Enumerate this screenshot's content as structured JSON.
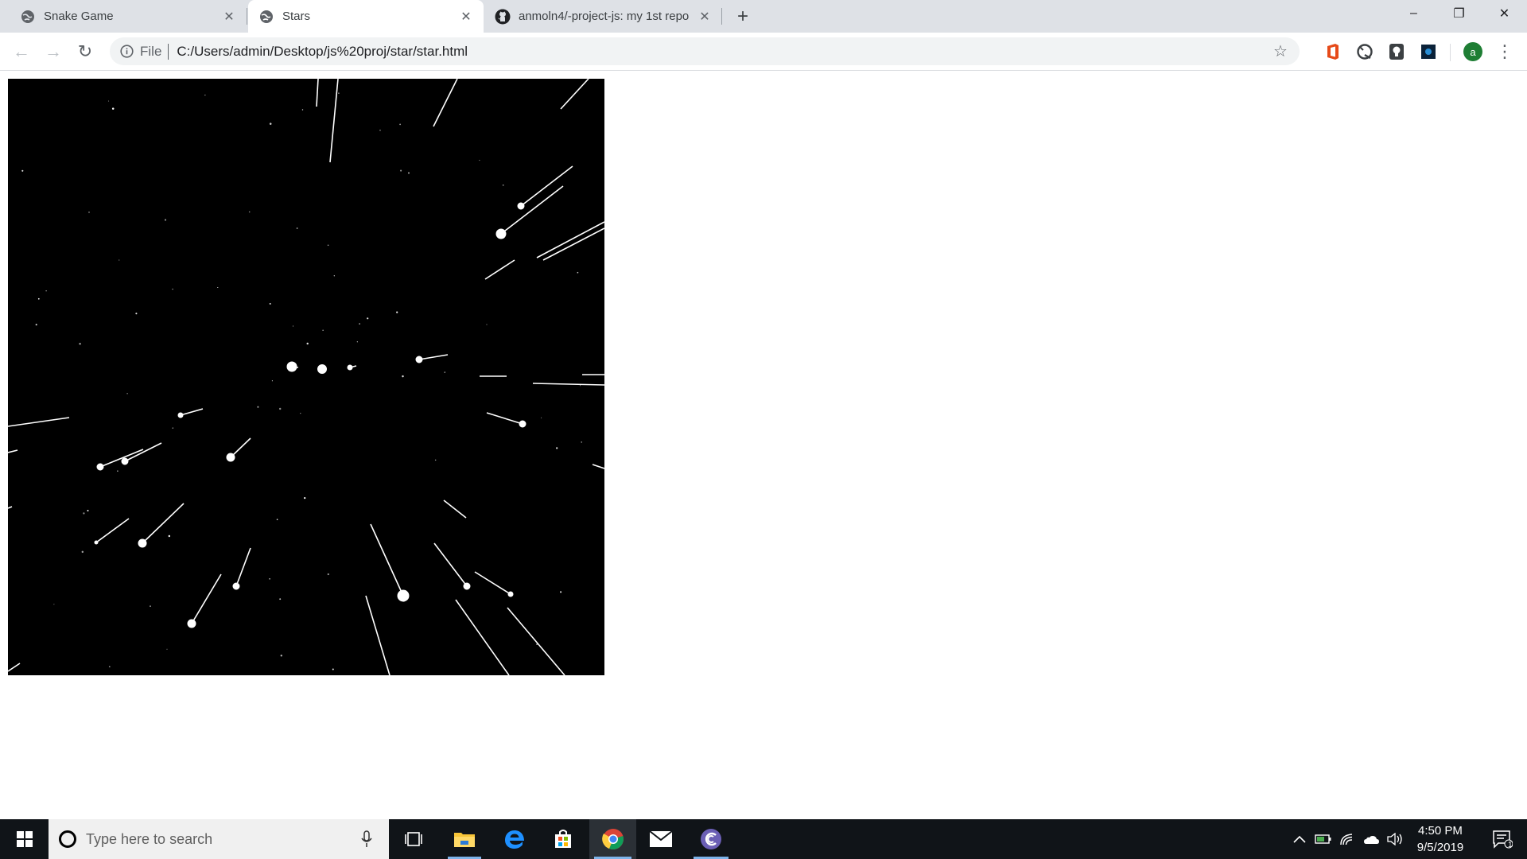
{
  "browser": {
    "tabs": [
      {
        "title": "Snake Game",
        "icon": "globe-icon",
        "active": false
      },
      {
        "title": "Stars",
        "icon": "globe-icon",
        "active": true
      },
      {
        "title": "anmoln4/-project-js: my 1st repo",
        "icon": "github-icon",
        "active": false
      }
    ],
    "new_tab_label": "+",
    "window_controls": {
      "minimize": "–",
      "restore": "❐",
      "close": "✕"
    },
    "toolbar": {
      "back": "←",
      "forward": "→",
      "reload": "↻",
      "scheme_label": "File",
      "url": "C:/Users/admin/Desktop/js%20proj/star/star.html",
      "bookmark": "☆",
      "extensions": [
        "office-icon",
        "quip-icon",
        "lightbulb-extension-icon",
        "dark-extension-icon"
      ],
      "profile_initial": "a",
      "menu": "⋮"
    }
  },
  "page": {
    "canvas": "starfield-animation"
  },
  "taskbar": {
    "search_placeholder": "Type here to search",
    "apps": [
      "task-view-icon",
      "file-explorer-icon",
      "edge-icon",
      "store-icon",
      "chrome-icon",
      "mail-icon",
      "third-party-app-icon"
    ],
    "tray": {
      "time": "4:50 PM",
      "date": "9/5/2019",
      "notifications_count": "1"
    }
  },
  "colors": {
    "tab_strip": "#dee1e6",
    "omnibox": "#f1f3f4",
    "canvas_bg": "#000000",
    "taskbar": "#101418"
  }
}
